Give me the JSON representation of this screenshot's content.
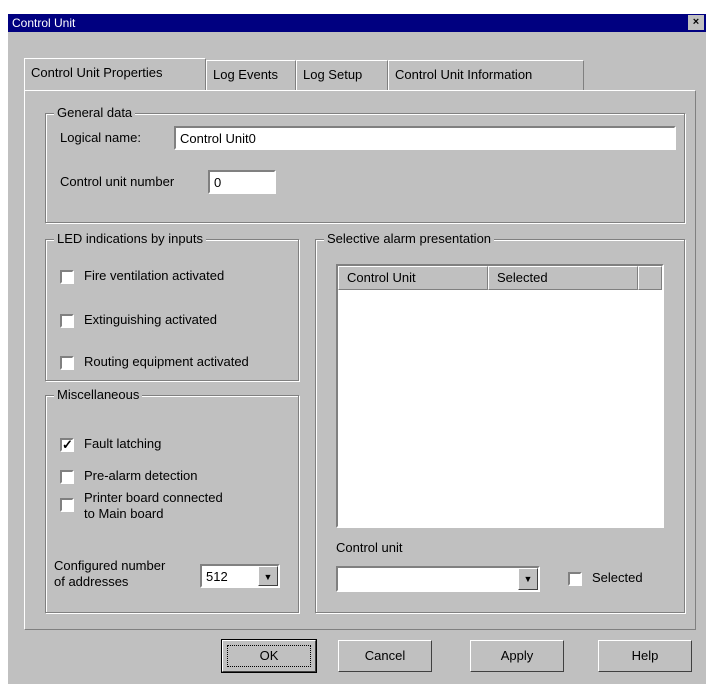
{
  "window": {
    "title": "Control Unit",
    "close_glyph": "×"
  },
  "tabs": [
    {
      "label": "Control Unit Properties"
    },
    {
      "label": "Log Events"
    },
    {
      "label": "Log Setup"
    },
    {
      "label": "Control Unit Information"
    }
  ],
  "general": {
    "title": "General data",
    "logical_name_label": "Logical name:",
    "logical_name_value": "Control Unit0",
    "unit_number_label": "Control unit number",
    "unit_number_value": "0"
  },
  "led": {
    "title": "LED indications by inputs",
    "items": [
      {
        "label": "Fire ventilation activated",
        "checked": false
      },
      {
        "label": "Extinguishing activated",
        "checked": false
      },
      {
        "label": "Routing equipment activated",
        "checked": false
      }
    ]
  },
  "misc": {
    "title": "Miscellaneous",
    "items": [
      {
        "label": "Fault latching",
        "checked": true,
        "mark": "✓"
      },
      {
        "label": "Pre-alarm detection",
        "checked": false
      },
      {
        "label_line1": "Printer board connected",
        "label_line2": "to Main board",
        "checked": false
      }
    ],
    "addresses_label_line1": "Configured number",
    "addresses_label_line2": "of addresses",
    "addresses_value": "512",
    "dropdown_icon": "▼"
  },
  "selective": {
    "title": "Selective alarm presentation",
    "columns": [
      "Control Unit",
      "Selected"
    ],
    "control_unit_label": "Control unit",
    "control_unit_value": "",
    "dropdown_icon": "▼",
    "selected_label": "Selected",
    "selected_checked": false
  },
  "buttons": {
    "ok": "OK",
    "cancel": "Cancel",
    "apply": "Apply",
    "help": "Help"
  }
}
